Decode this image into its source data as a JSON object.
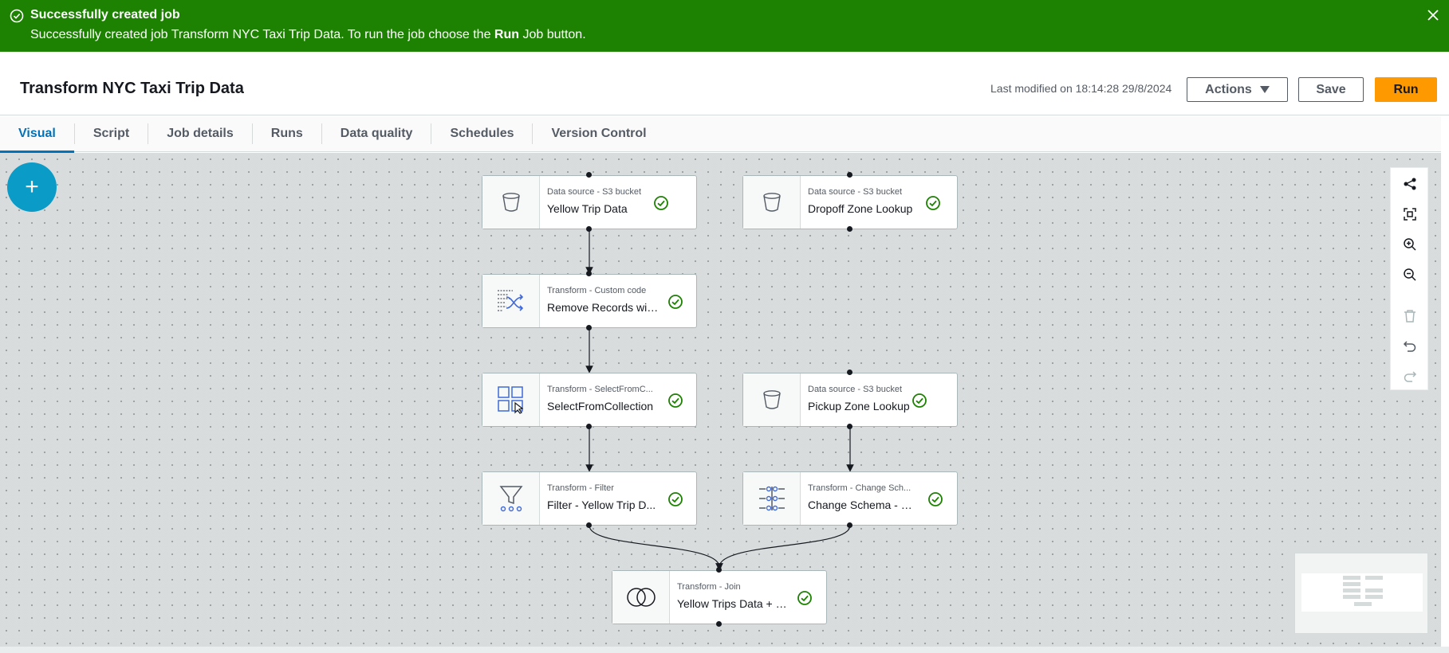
{
  "flash": {
    "title": "Successfully created job",
    "message_prefix": "Successfully created job Transform NYC Taxi Trip Data. To run the job choose the ",
    "message_bold": "Run",
    "message_suffix": " Job button.",
    "color": "#1d8102"
  },
  "header": {
    "title": "Transform NYC Taxi Trip Data",
    "last_modified": "Last modified on 18:14:28 29/8/2024",
    "actions_label": "Actions",
    "save_label": "Save",
    "run_label": "Run"
  },
  "tabs": [
    {
      "label": "Visual",
      "active": true
    },
    {
      "label": "Script"
    },
    {
      "label": "Job details"
    },
    {
      "label": "Runs"
    },
    {
      "label": "Data quality"
    },
    {
      "label": "Schedules"
    },
    {
      "label": "Version Control"
    }
  ],
  "canvas": {
    "add_button": "+",
    "nodes": [
      {
        "id": "yellow-trip-data",
        "type": "Data source - S3 bucket",
        "name": "Yellow Trip Data",
        "icon": "bucket-icon"
      },
      {
        "id": "dropoff-zone-lookup",
        "type": "Data source - S3 bucket",
        "name": "Dropoff Zone Lookup",
        "icon": "bucket-icon"
      },
      {
        "id": "remove-records",
        "type": "Transform - Custom code",
        "name": "Remove Records wit...",
        "icon": "custom-code-icon"
      },
      {
        "id": "select-from-collection",
        "type": "Transform - SelectFromC...",
        "name": "SelectFromCollection",
        "icon": "select-collection-icon"
      },
      {
        "id": "pickup-zone-lookup",
        "type": "Data source - S3 bucket",
        "name": "Pickup Zone Lookup",
        "icon": "bucket-icon"
      },
      {
        "id": "filter-yellow-trip",
        "type": "Transform - Filter",
        "name": "Filter - Yellow Trip D...",
        "icon": "filter-icon"
      },
      {
        "id": "change-schema",
        "type": "Transform - Change Sch...",
        "name": "Change Schema - Pic...",
        "icon": "change-schema-icon"
      },
      {
        "id": "join",
        "type": "Transform - Join",
        "name": "Yellow Trips Data + P...",
        "icon": "join-icon"
      }
    ]
  },
  "toolbar": [
    "layout-icon",
    "fit-screen-icon",
    "zoom-in-icon",
    "zoom-out-icon",
    "delete-icon",
    "undo-icon",
    "redo-icon"
  ],
  "colors": {
    "accent": "#0073bb",
    "run": "#ff9900",
    "success": "#1d8102",
    "node_icon_blue": "#3f6ad8"
  }
}
